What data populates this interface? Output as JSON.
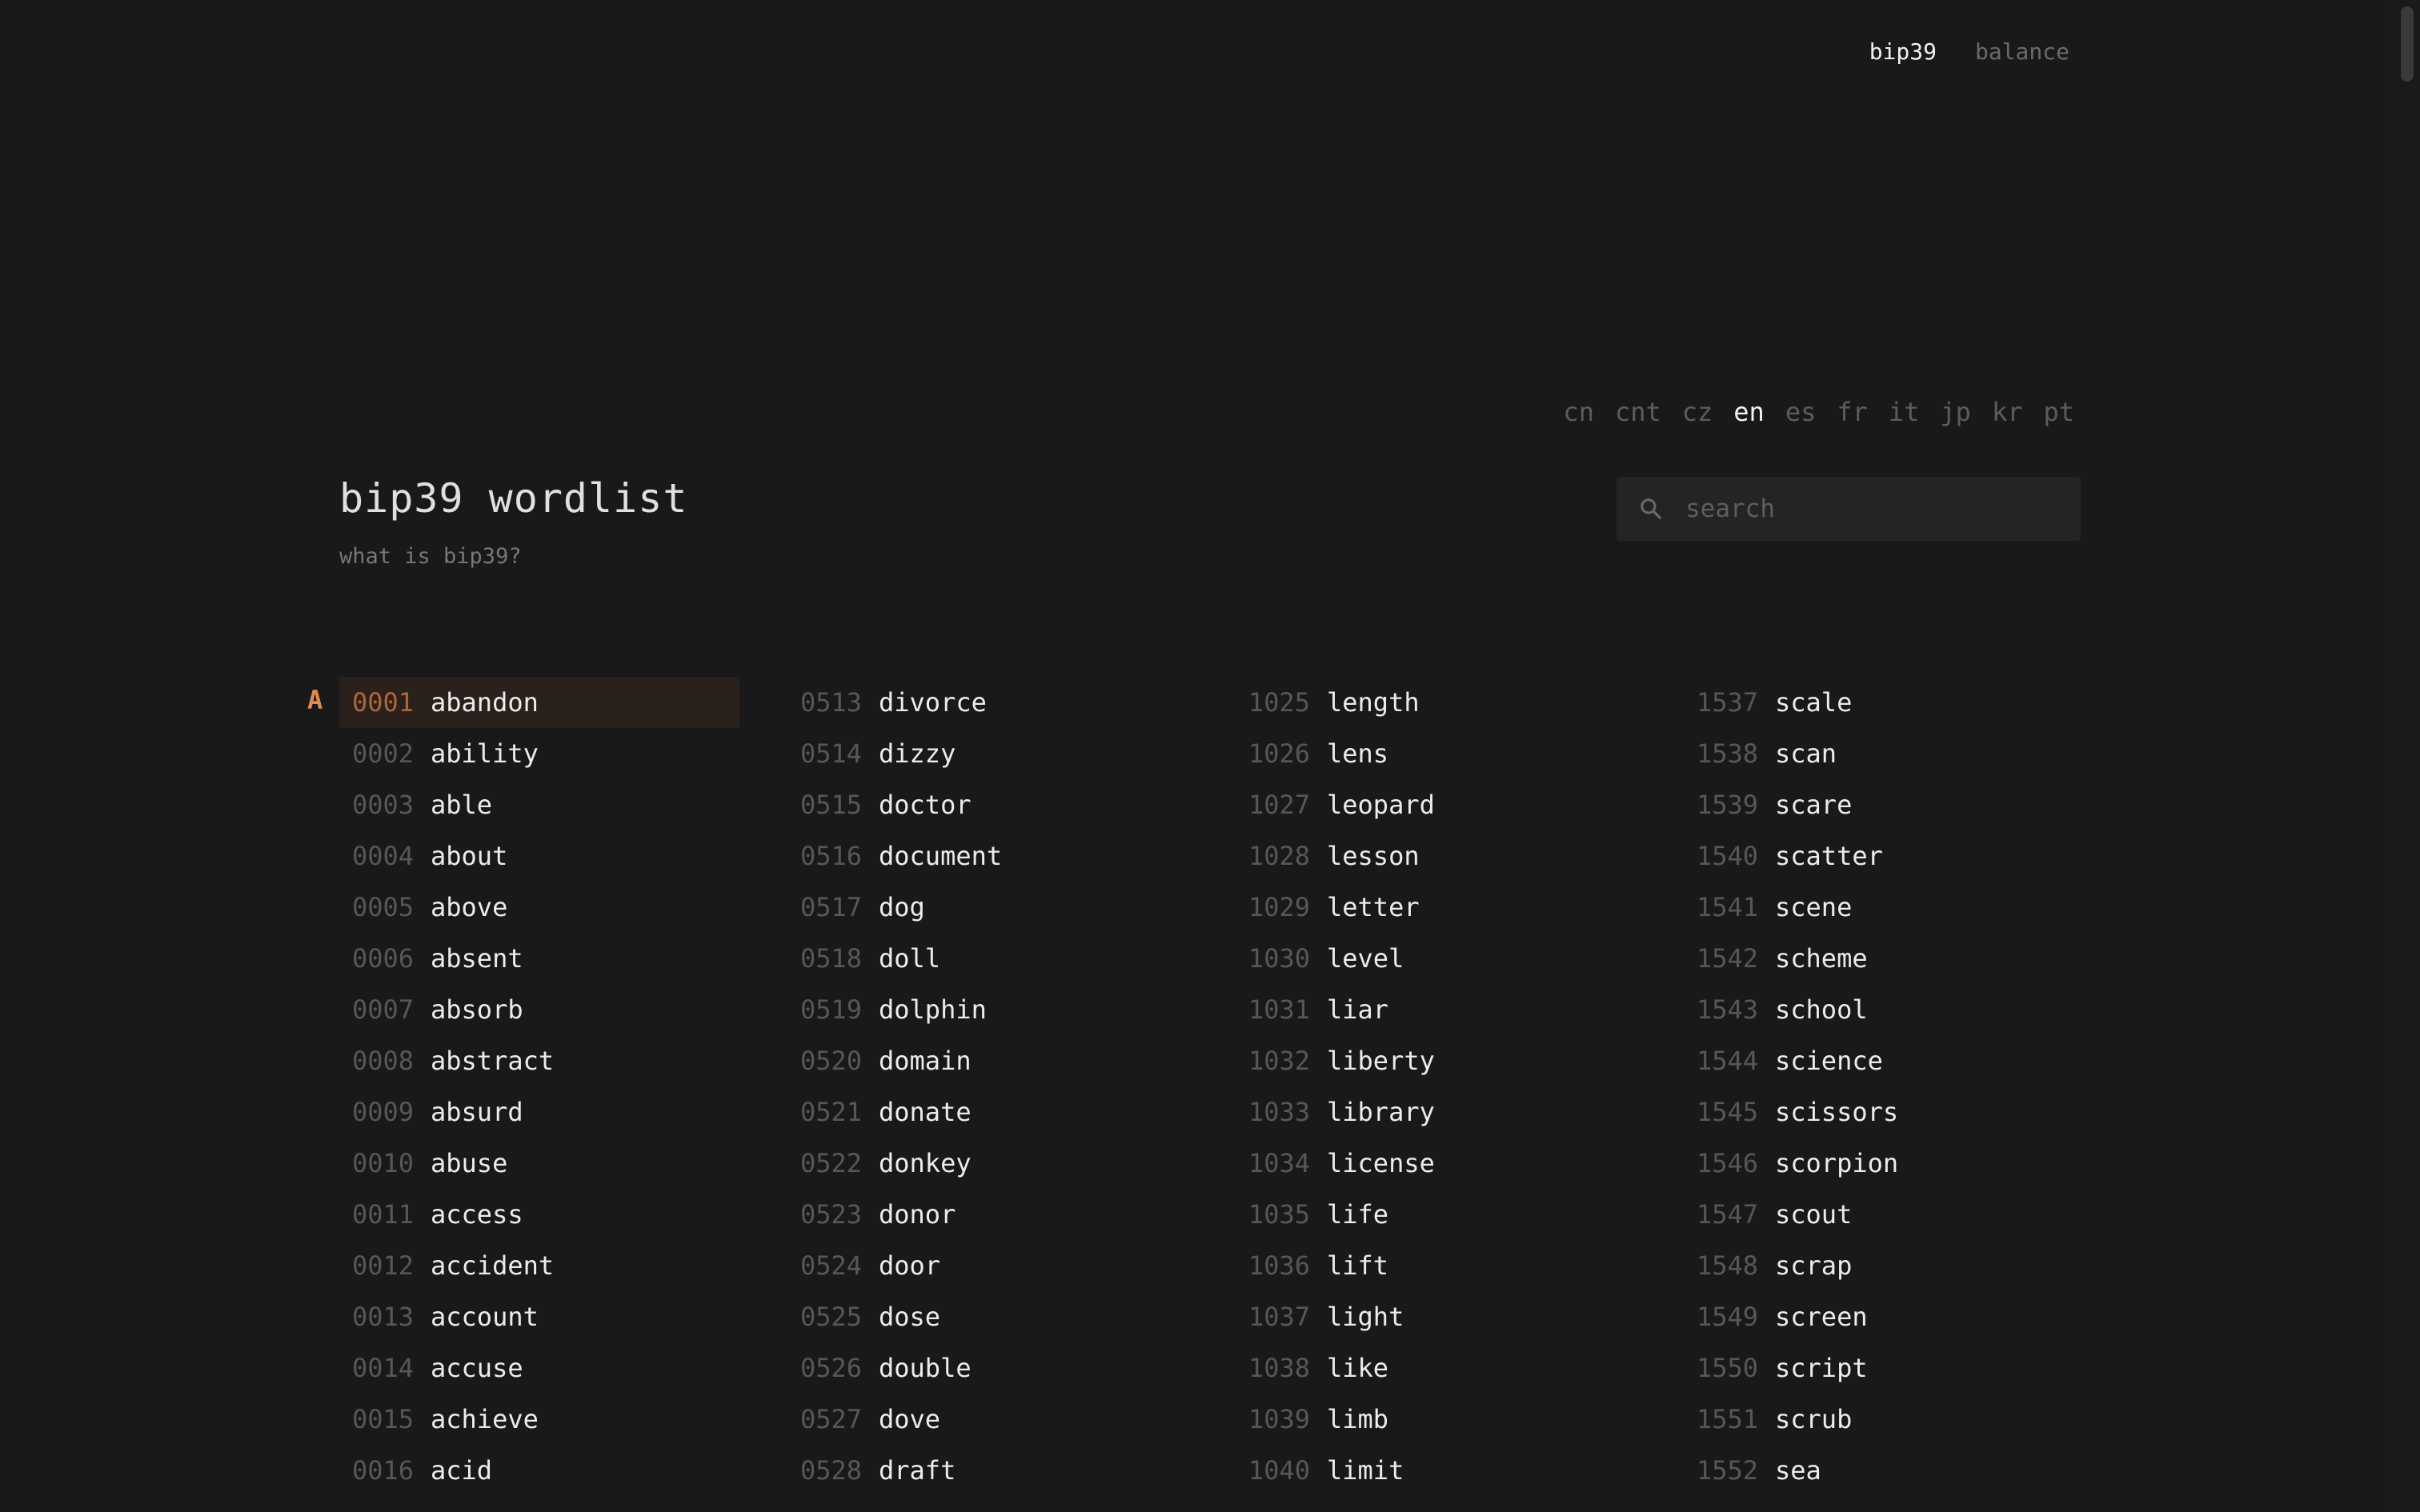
{
  "nav": {
    "items": [
      {
        "label": "bip39",
        "active": true
      },
      {
        "label": "balance",
        "active": false
      }
    ]
  },
  "languages": {
    "items": [
      "cn",
      "cnt",
      "cz",
      "en",
      "es",
      "fr",
      "it",
      "jp",
      "kr",
      "pt"
    ],
    "selected": "en"
  },
  "header": {
    "title": "bip39 wordlist",
    "subtitle": "what is bip39?"
  },
  "search": {
    "placeholder": "search",
    "value": ""
  },
  "wordlist": {
    "section_letter": "A",
    "selected_index": "0001",
    "columns": [
      [
        [
          "0001",
          "abandon"
        ],
        [
          "0002",
          "ability"
        ],
        [
          "0003",
          "able"
        ],
        [
          "0004",
          "about"
        ],
        [
          "0005",
          "above"
        ],
        [
          "0006",
          "absent"
        ],
        [
          "0007",
          "absorb"
        ],
        [
          "0008",
          "abstract"
        ],
        [
          "0009",
          "absurd"
        ],
        [
          "0010",
          "abuse"
        ],
        [
          "0011",
          "access"
        ],
        [
          "0012",
          "accident"
        ],
        [
          "0013",
          "account"
        ],
        [
          "0014",
          "accuse"
        ],
        [
          "0015",
          "achieve"
        ],
        [
          "0016",
          "acid"
        ]
      ],
      [
        [
          "0513",
          "divorce"
        ],
        [
          "0514",
          "dizzy"
        ],
        [
          "0515",
          "doctor"
        ],
        [
          "0516",
          "document"
        ],
        [
          "0517",
          "dog"
        ],
        [
          "0518",
          "doll"
        ],
        [
          "0519",
          "dolphin"
        ],
        [
          "0520",
          "domain"
        ],
        [
          "0521",
          "donate"
        ],
        [
          "0522",
          "donkey"
        ],
        [
          "0523",
          "donor"
        ],
        [
          "0524",
          "door"
        ],
        [
          "0525",
          "dose"
        ],
        [
          "0526",
          "double"
        ],
        [
          "0527",
          "dove"
        ],
        [
          "0528",
          "draft"
        ]
      ],
      [
        [
          "1025",
          "length"
        ],
        [
          "1026",
          "lens"
        ],
        [
          "1027",
          "leopard"
        ],
        [
          "1028",
          "lesson"
        ],
        [
          "1029",
          "letter"
        ],
        [
          "1030",
          "level"
        ],
        [
          "1031",
          "liar"
        ],
        [
          "1032",
          "liberty"
        ],
        [
          "1033",
          "library"
        ],
        [
          "1034",
          "license"
        ],
        [
          "1035",
          "life"
        ],
        [
          "1036",
          "lift"
        ],
        [
          "1037",
          "light"
        ],
        [
          "1038",
          "like"
        ],
        [
          "1039",
          "limb"
        ],
        [
          "1040",
          "limit"
        ]
      ],
      [
        [
          "1537",
          "scale"
        ],
        [
          "1538",
          "scan"
        ],
        [
          "1539",
          "scare"
        ],
        [
          "1540",
          "scatter"
        ],
        [
          "1541",
          "scene"
        ],
        [
          "1542",
          "scheme"
        ],
        [
          "1543",
          "school"
        ],
        [
          "1544",
          "science"
        ],
        [
          "1545",
          "scissors"
        ],
        [
          "1546",
          "scorpion"
        ],
        [
          "1547",
          "scout"
        ],
        [
          "1548",
          "scrap"
        ],
        [
          "1549",
          "screen"
        ],
        [
          "1550",
          "script"
        ],
        [
          "1551",
          "scrub"
        ],
        [
          "1552",
          "sea"
        ]
      ]
    ]
  },
  "colors": {
    "background": "#191919",
    "accent": "#e58a4e",
    "selected_row_bg": "#2a211c"
  }
}
